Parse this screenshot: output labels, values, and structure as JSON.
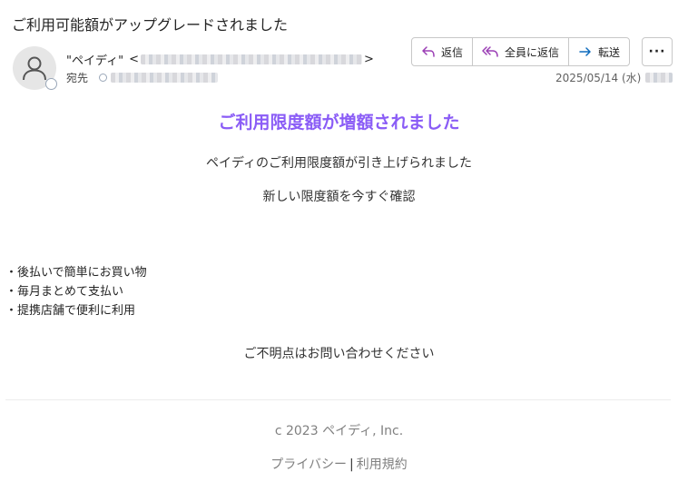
{
  "email": {
    "subject": "ご利用可能額がアップグレードされました",
    "sender_name": "\"ペイディ\"",
    "sender_open": "<",
    "sender_close": ">",
    "to_label": "宛先",
    "date": "2025/05/14 (水)"
  },
  "toolbar": {
    "reply": "返信",
    "reply_all": "全員に返信",
    "forward": "転送",
    "more": "···"
  },
  "body": {
    "headline": "ご利用限度額が増額されました",
    "line1": "ペイディのご利用限度額が引き上げられました",
    "line2": "新しい限度額を今すぐ確認",
    "bullets": [
      "・後払いで簡単にお買い物",
      "・毎月まとめて支払い",
      "・提携店舗で便利に利用"
    ],
    "contact": "ご不明点はお問い合わせください",
    "copyright": "c 2023 ペイディ, Inc.",
    "privacy": "プライバシー",
    "link_sep": "|",
    "terms": "利用規約"
  },
  "colors": {
    "accent": "#8a5cf6",
    "reply_icon": "#9b3fb5",
    "forward_icon": "#0f6cbd"
  }
}
